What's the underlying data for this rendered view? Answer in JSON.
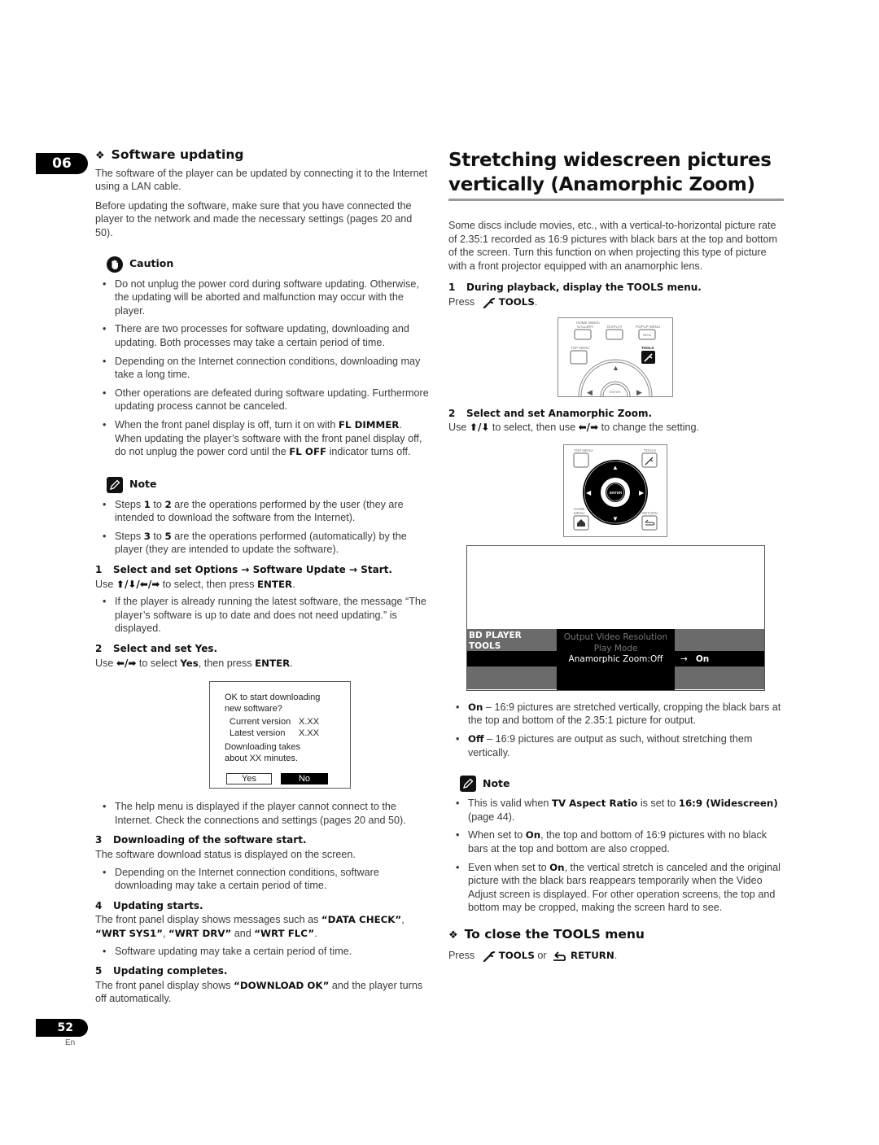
{
  "chapter": "06",
  "page": {
    "number": "52",
    "lang": "En"
  },
  "left": {
    "section_title": "Software updating",
    "intro": [
      "The software of the player can be updated by connecting it to the Internet using a LAN cable.",
      "Before updating the software, make sure that you have connected the player to the network and made the necessary settings (pages 20 and 50)."
    ],
    "caution": {
      "title": "Caution",
      "items": [
        "Do not unplug the power cord during software updating. Otherwise, the updating will be aborted and malfunction may occur with the player.",
        "There are two processes for software updating, downloading and updating. Both processes may take a certain period of time.",
        "Depending on the Internet connection conditions, downloading may take a long time.",
        "Other operations are defeated during software updating. Furthermore updating process cannot be canceled."
      ],
      "last_item": {
        "a": "When the front panel display is off, turn it on with ",
        "b": "FL DIMMER",
        "c": ". When updating the player’s software with the front panel display off, do not unplug the power cord until the ",
        "d": "FL OFF",
        "e": " indicator turns off."
      }
    },
    "note": {
      "title": "Note",
      "items": [
        {
          "a": "Steps ",
          "b": "1",
          "c": " to ",
          "d": "2",
          "e": " are the operations performed by the user (they are intended to download the software from the Internet)."
        },
        {
          "a": "Steps ",
          "b": "3",
          "c": " to ",
          "d": "5",
          "e": " are the operations performed (automatically) by the player (they are intended to update the software)."
        }
      ]
    },
    "step1": {
      "num": "1",
      "title": "Select and set Options → Software Update → Start.",
      "use": "Use",
      "arrows": "⬆/⬇/⬅/➡",
      "text": " to select, then press ",
      "key": "ENTER",
      "end": ".",
      "bullet": "If the player is already running the latest software, the message “The player’s software is up to date and does not need updating.” is displayed."
    },
    "step2": {
      "num": "2",
      "title": "Select and set Yes.",
      "use": "Use",
      "arrows": "⬅/➡",
      "text": " to select ",
      "key1": "Yes",
      "text2": ", then press ",
      "key2": "ENTER",
      "end": "."
    },
    "dialog": {
      "line1": "OK to start downloading",
      "line2": "new software?",
      "current_label": "Current version",
      "current_value": "X.XX",
      "latest_label": "Latest version",
      "latest_value": "X.XX",
      "line5": "Downloading takes",
      "line6": "about XX minutes.",
      "yes": "Yes",
      "no": "No"
    },
    "help_bullet": "The help menu is displayed if the player cannot connect to the Internet. Check the connections and settings (pages 20 and 50).",
    "step3": {
      "num": "3",
      "title": "Downloading of the software start.",
      "text": "The software download status is displayed on the screen.",
      "bullet": "Depending on the Internet connection conditions, software downloading may take a certain period of time."
    },
    "step4": {
      "num": "4",
      "title": "Updating starts.",
      "a": "The front panel display shows messages such as ",
      "m1": "“DATA CHECK”",
      "s1": ", ",
      "m2": "“WRT SYS1”",
      "s2": ", ",
      "m3": "“WRT DRV”",
      "s3": " and ",
      "m4": "“WRT FLC”",
      "end": ".",
      "bullet": "Software updating may take a certain period of time."
    },
    "step5": {
      "num": "5",
      "title": "Updating completes.",
      "a": "The front panel display shows ",
      "m": "“DOWNLOAD OK”",
      "b": " and the player turns off automatically."
    }
  },
  "right": {
    "title_line1": "Stretching widescreen pictures",
    "title_line2": "vertically (Anamorphic Zoom)",
    "intro": "Some discs include movies, etc., with a vertical-to-horizontal picture rate of 2.35:1 recorded as 16:9 pictures with black bars at the top and bottom of the screen. Turn this function on when projecting this type of picture with a front projector equipped with an anamorphic lens.",
    "step1": {
      "num": "1",
      "title": "During playback, display the TOOLS menu.",
      "press": "Press",
      "key": "TOOLS",
      "end": "."
    },
    "remote1": {
      "home_media_gallery": "HOME MEDIA GALLERY",
      "display": "DISPLAY",
      "popup_menu": "POPUP MENU",
      "menu": "MENU",
      "top_menu": "TOP MENU",
      "tools": "TOOLS",
      "enter": "ENTER"
    },
    "step2": {
      "num": "2",
      "title": "Select and set Anamorphic Zoom.",
      "use": "Use",
      "arrows1": "⬆/⬇",
      "text1": " to select, then use ",
      "arrows2": "⬅/➡",
      "text2": " to change the setting."
    },
    "remote2": {
      "top_menu": "TOP MENU",
      "tools": "TOOLS",
      "enter": "ENTER",
      "home_menu": "HOME MENU",
      "return": "RETURN"
    },
    "tools_screen": {
      "header_line1": "BD PLAYER",
      "header_line2": "TOOLS",
      "item1": "Output Video Resolution",
      "item2": "Play Mode",
      "selected": "Anamorphic Zoom:Off",
      "arrow": "→",
      "value": "On"
    },
    "options": [
      {
        "key": "On",
        "text": " – 16:9 pictures are stretched vertically, cropping the black bars at the top and bottom of the 2.35:1 picture for output."
      },
      {
        "key": "Off",
        "text": " – 16:9 pictures are output as such, without stretching them vertically."
      }
    ],
    "note": {
      "title": "Note",
      "item1": {
        "a": "This is valid when ",
        "b": "TV Aspect Ratio",
        "c": " is set to ",
        "d": "16:9 (Widescreen)",
        "e": " (page 44)."
      },
      "item2": {
        "a": "When set to ",
        "b": "On",
        "c": ", the top and bottom of 16:9 pictures with no black bars at the top and bottom are also cropped."
      },
      "item3": {
        "a": "Even when set to ",
        "b": "On",
        "c": ", the vertical stretch is canceled and the original picture with the black bars reappears temporarily when the Video Adjust screen is displayed. For other operation screens, the top and bottom may be cropped, making the screen hard to see."
      }
    },
    "close": {
      "title": "To close the TOOLS menu",
      "press": "Press",
      "key1": "TOOLS",
      "or": " or ",
      "key2": "RETURN",
      "end": "."
    }
  }
}
